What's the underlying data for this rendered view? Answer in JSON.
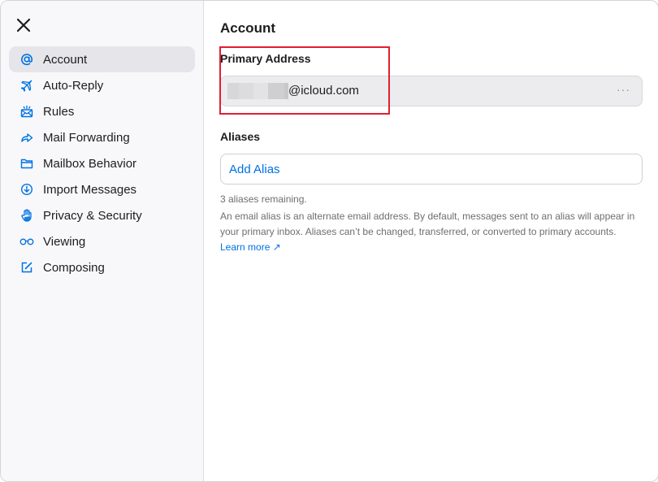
{
  "sidebar": {
    "items": [
      {
        "label": "Account",
        "icon": "at-icon",
        "active": true
      },
      {
        "label": "Auto-Reply",
        "icon": "airplane-icon",
        "active": false
      },
      {
        "label": "Rules",
        "icon": "rules-envelope-icon",
        "active": false
      },
      {
        "label": "Mail Forwarding",
        "icon": "forward-arrow-icon",
        "active": false
      },
      {
        "label": "Mailbox Behavior",
        "icon": "folder-icon",
        "active": false
      },
      {
        "label": "Import Messages",
        "icon": "download-circle-icon",
        "active": false
      },
      {
        "label": "Privacy & Security",
        "icon": "hand-icon",
        "active": false
      },
      {
        "label": "Viewing",
        "icon": "glasses-icon",
        "active": false
      },
      {
        "label": "Composing",
        "icon": "compose-icon",
        "active": false
      }
    ]
  },
  "main": {
    "title": "Account",
    "primary_address": {
      "label": "Primary Address",
      "value_suffix": "@icloud.com",
      "more_label": "···"
    },
    "aliases": {
      "label": "Aliases",
      "add_button": "Add Alias",
      "remaining": "3 aliases remaining.",
      "description": "An email alias is an alternate email address. By default, messages sent to an alias will appear in your primary inbox. Aliases can’t be changed, transferred, or converted to primary accounts.",
      "learn_more": "Learn more",
      "learn_more_icon": "↗"
    }
  },
  "colors": {
    "accent": "#0071e3",
    "highlight_box": "#e02030"
  }
}
